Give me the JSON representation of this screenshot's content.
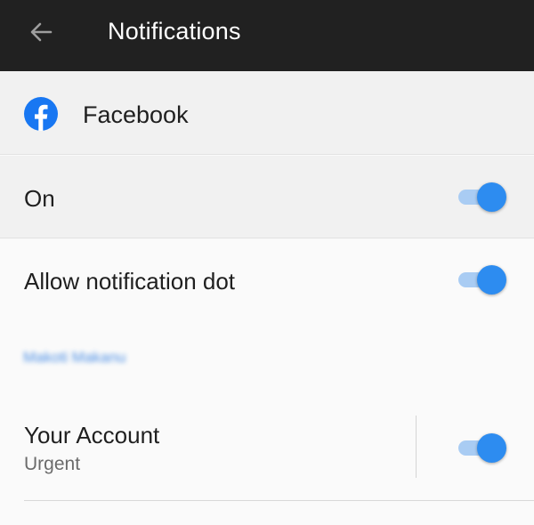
{
  "appbar": {
    "title": "Notifications",
    "back_icon": "arrow-left-icon"
  },
  "app": {
    "name": "Facebook",
    "icon": "facebook-logo-icon",
    "brand_color": "#1877f2"
  },
  "settings": {
    "master": {
      "label": "On",
      "enabled": true
    },
    "notification_dot": {
      "label": "Allow notification dot",
      "enabled": true
    }
  },
  "channel_group": {
    "header": "Makoti Makanu",
    "channels": [
      {
        "name": "Your Account",
        "importance": "Urgent",
        "enabled": true
      }
    ]
  },
  "colors": {
    "toggle_thumb": "#2d8cf0",
    "toggle_track": "#a9ccf3",
    "appbar_bg": "#212121"
  }
}
